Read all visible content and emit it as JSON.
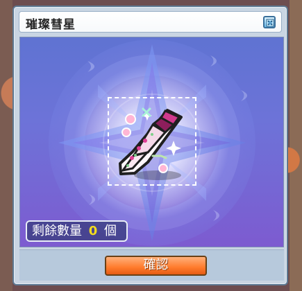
{
  "window": {
    "title": "璀璨彗星",
    "icons": {
      "close": "close-icon",
      "item": "comet-weapon-icon"
    }
  },
  "count": {
    "label": "剩餘數量",
    "value": "0",
    "unit": "個"
  },
  "actions": {
    "confirm_label": "確認"
  },
  "colors": {
    "window_border": "#5d7892",
    "window_fill": "#c9d5e3",
    "count_highlight": "#f3dc1f",
    "confirm_button": "#ff7b2c"
  }
}
